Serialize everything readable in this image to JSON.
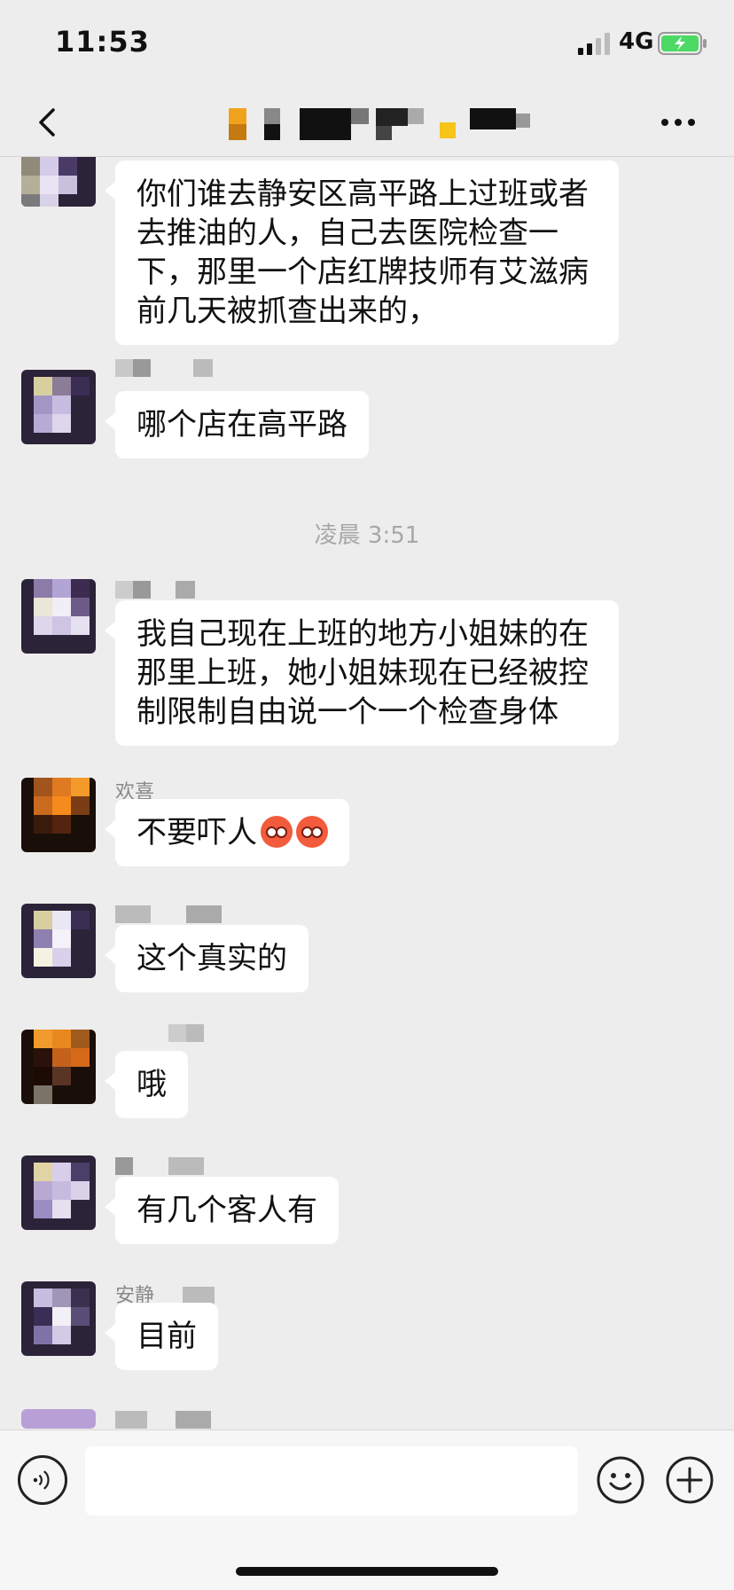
{
  "status_bar": {
    "time": "11:53",
    "network": "4G",
    "battery_color": "#4cd964"
  },
  "nav": {
    "back_icon": "chevron-left-icon",
    "more_icon": "ellipsis-icon"
  },
  "messages": [
    {
      "text": "你们谁去静安区高平路上过班或者去推油的人，自己去医院检查一下，那里一个店红牌技师有艾滋病前几天被抓查出来的，",
      "sender_visible": ""
    },
    {
      "text": "哪个店在高平路",
      "sender_visible": ""
    },
    {
      "text": "我自己现在上班的地方小姐妹的在那里上班，她小姐妹现在已经被控制限制自由说一个一个检查身体",
      "sender_visible": ""
    },
    {
      "text": "不要吓人",
      "sender_visible": "欢喜",
      "emoji": "flushed-face-icon"
    },
    {
      "text": "这个真实的",
      "sender_visible": ""
    },
    {
      "text": "哦",
      "sender_visible": ""
    },
    {
      "text": "有几个客人有",
      "sender_visible": ""
    },
    {
      "text": "目前",
      "sender_visible": "安静"
    }
  ],
  "time_divider": "凌晨 3:51",
  "input_bar": {
    "placeholder": "",
    "voice_icon": "voice-icon",
    "emoji_icon": "smiley-icon",
    "plus_icon": "plus-icon"
  },
  "colors": {
    "background": "#ededed",
    "bubble": "#ffffff",
    "input_bar": "#f6f6f6"
  }
}
